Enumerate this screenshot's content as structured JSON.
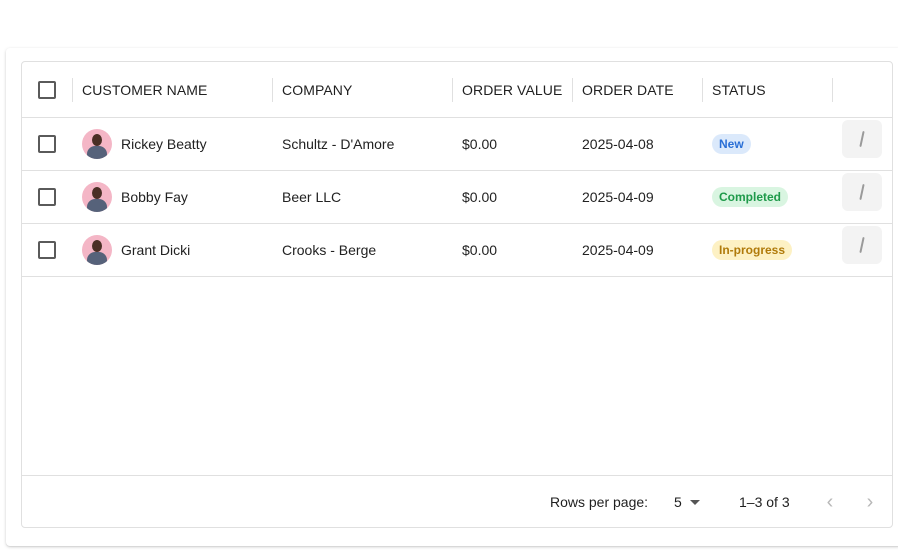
{
  "table": {
    "columns": {
      "customer_name": "CUSTOMER NAME",
      "company": "COMPANY",
      "order_value": "ORDER VALUE",
      "order_date": "ORDER DATE",
      "status": "STATUS"
    },
    "rows": [
      {
        "name": "Rickey Beatty",
        "company": "Schultz - D'Amore",
        "value": "$0.00",
        "date": "2025-04-08",
        "status": "New"
      },
      {
        "name": "Bobby Fay",
        "company": "Beer LLC",
        "value": "$0.00",
        "date": "2025-04-09",
        "status": "Completed"
      },
      {
        "name": "Grant Dicki",
        "company": "Crooks - Berge",
        "value": "$0.00",
        "date": "2025-04-09",
        "status": "In-progress"
      }
    ]
  },
  "status_colors": {
    "New": {
      "bg": "#dbe9fb",
      "fg": "#2a6fd6"
    },
    "Completed": {
      "bg": "#d9f5e1",
      "fg": "#1e9a4a"
    },
    "In-progress": {
      "bg": "#fdf1c4",
      "fg": "#b07a0a"
    }
  },
  "pagination": {
    "rows_per_page_label": "Rows per page:",
    "rows_per_page_value": "5",
    "range": "1–3 of 3",
    "prev_icon": "chevron-left-icon",
    "next_icon": "chevron-right-icon"
  }
}
